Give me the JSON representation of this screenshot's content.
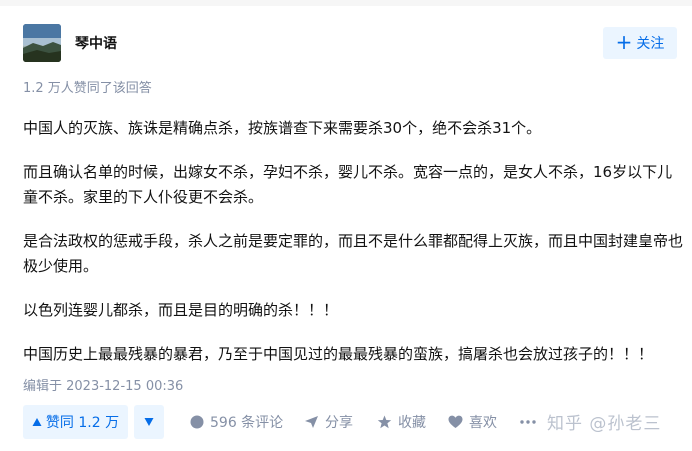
{
  "author": {
    "name": "琴中语",
    "avatar_icon": "landscape-avatar-icon"
  },
  "follow": {
    "label": "关注",
    "icon": "plus-icon"
  },
  "vote_meta": "1.2 万人赞同了该回答",
  "content": {
    "paragraphs": [
      "中国人的灭族、族诛是精确点杀，按族谱查下来需要杀30个，绝不会杀31个。",
      "而且确认名单的时候，出嫁女不杀，孕妇不杀，婴儿不杀。宽容一点的，是女人不杀，16岁以下儿童不杀。家里的下人仆役更不会杀。",
      "是合法政权的惩戒手段，杀人之前是要定罪的，而且不是什么罪都配得上灭族，而且中国封建皇帝也极少使用。",
      "以色列连婴儿都杀，而且是目的明确的杀！！！",
      "中国历史上最最残暴的暴君，乃至于中国见过的最最残暴的蛮族，搞屠杀也会放过孩子的！！！"
    ]
  },
  "edited": "编辑于 2023-12-15 00:36",
  "actions": {
    "vote_up": "赞同 1.2 万",
    "vote_down_icon": "triangle-down-icon",
    "comment": "596 条评论",
    "share": "分享",
    "collect": "收藏",
    "like": "喜欢",
    "more_icon": "more-icon"
  },
  "watermark": "知乎 @孙老三",
  "colors": {
    "accent": "#056de8",
    "accent_bg": "#ebf5ff",
    "meta_gray": "#8590a6",
    "text": "#121212"
  }
}
